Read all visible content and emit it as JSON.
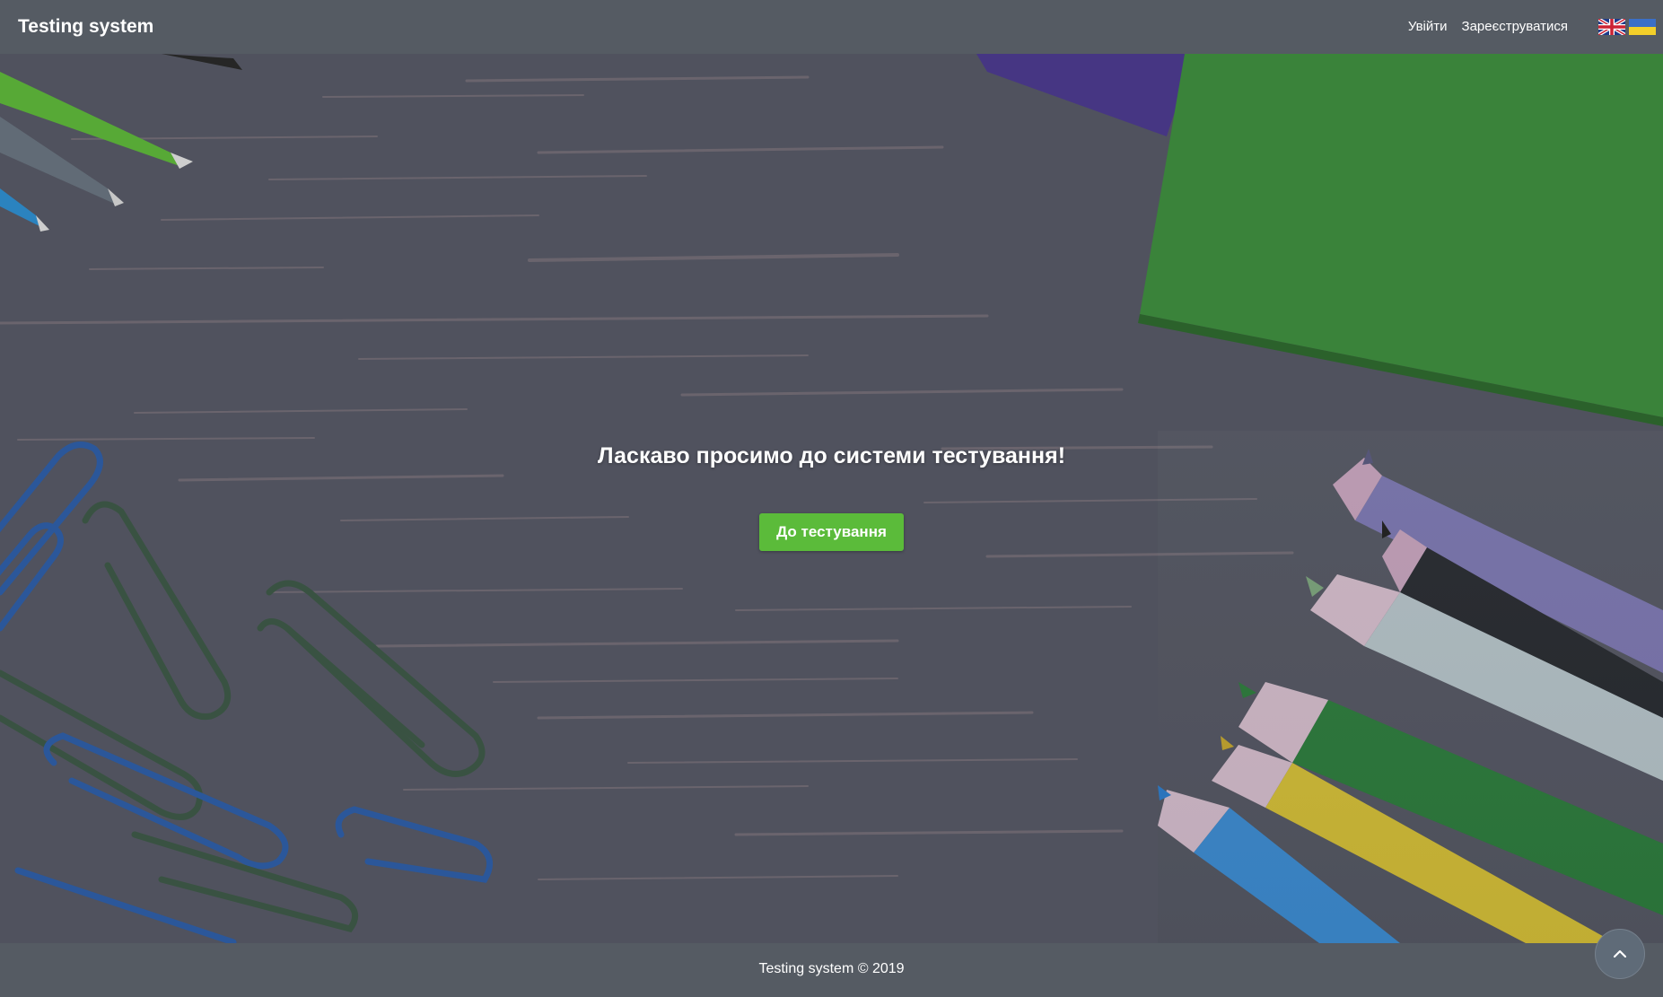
{
  "navbar": {
    "brand": "Testing system",
    "login_label": "Увійти",
    "register_label": "Зареєструватися",
    "languages": [
      {
        "name": "English",
        "icon": "uk-flag-icon"
      },
      {
        "name": "Українська",
        "icon": "ukraine-flag-icon"
      }
    ]
  },
  "hero": {
    "welcome_text": "Ласкаво просимо до системи тестування!",
    "cta_label": "До тестування",
    "cta_color": "#5bbb3a"
  },
  "footer": {
    "text": "Testing system © 2019"
  },
  "scroll_top": {
    "icon": "chevron-up-icon"
  },
  "colors": {
    "navbar": "#555b63",
    "background": "#575a66",
    "accent": "#5bbb3a"
  }
}
